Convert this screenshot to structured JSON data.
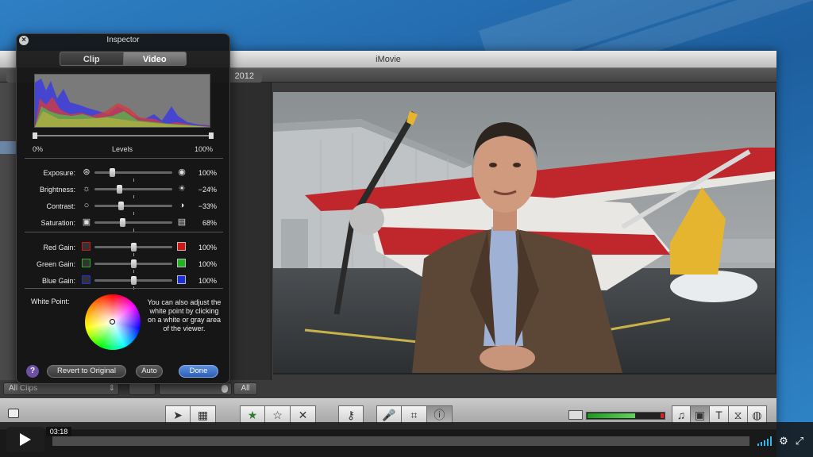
{
  "imovie": {
    "title": "iMovie",
    "event_date": "2012",
    "library": {
      "clips_filter": "All Clips",
      "all_button": "All"
    },
    "toolbar": {
      "tools": [
        {
          "name": "select-tool",
          "icon": "arrow-pointer-icon"
        },
        {
          "name": "add-to-project",
          "icon": "film-add-icon"
        },
        {
          "name": "favorite",
          "icon": "filled-star-icon"
        },
        {
          "name": "unmark",
          "icon": "empty-star-icon"
        },
        {
          "name": "reject",
          "icon": "x-icon"
        },
        {
          "name": "keyword",
          "icon": "key-icon"
        },
        {
          "name": "voiceover",
          "icon": "microphone-icon"
        },
        {
          "name": "crop",
          "icon": "crop-icon"
        },
        {
          "name": "inspector",
          "icon": "info-icon"
        }
      ],
      "browsers": [
        "music-note-icon",
        "camera-icon",
        "title-t-icon",
        "transition-icon",
        "globe-icon"
      ],
      "level_meter": 0.62
    }
  },
  "inspector": {
    "title": "Inspector",
    "tabs": [
      {
        "label": "Clip",
        "active": false
      },
      {
        "label": "Video",
        "active": true
      }
    ],
    "levels": {
      "min_label": "0%",
      "label": "Levels",
      "max_label": "100%"
    },
    "adjustments": [
      {
        "label": "Exposure:",
        "value": "100%",
        "level": 0.22,
        "icon_left": "exposure-aperture-icon",
        "icon_right": "exposure-dot-icon"
      },
      {
        "label": "Brightness:",
        "value": "−24%",
        "level": 0.32,
        "icon_left": "sun-small-icon",
        "icon_right": "sun-large-icon"
      },
      {
        "label": "Contrast:",
        "value": "−33%",
        "level": 0.34,
        "icon_left": "circle-outline-icon",
        "icon_right": "half-circle-icon"
      },
      {
        "label": "Saturation:",
        "value": "68%",
        "level": 0.36,
        "icon_left": "gray-swatch-icon",
        "icon_right": "color-swatch-icon"
      }
    ],
    "gains": [
      {
        "label": "Red Gain:",
        "value": "100%",
        "level": 0.5,
        "color": "#d31414"
      },
      {
        "label": "Green Gain:",
        "value": "100%",
        "level": 0.5,
        "color": "#21b321"
      },
      {
        "label": "Blue Gain:",
        "value": "100%",
        "level": 0.5,
        "color": "#1c2fd8"
      }
    ],
    "white_point": {
      "label": "White Point:",
      "help": "You can also adjust the white point by clicking on a white or gray area of the viewer."
    },
    "buttons": {
      "help": "?",
      "revert": "Revert to Original",
      "auto": "Auto",
      "done": "Done"
    }
  },
  "player": {
    "timecode": "03:18",
    "progress": 0.0
  },
  "colors": {
    "accent_blue": "#2d5fb7",
    "meter_green": "#5fd35f",
    "volume_blue": "#35b8f0"
  }
}
